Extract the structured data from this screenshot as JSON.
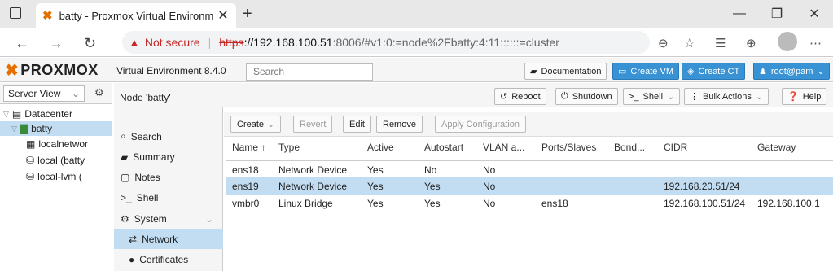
{
  "browser": {
    "tab_title": "batty - Proxmox Virtual Environm",
    "new_tab": "+",
    "address": {
      "warning": "Not secure",
      "scheme": "https",
      "host": "://192.168.100.51",
      "path": ":8006/#v1:0:=node%2Fbatty:4:11::::::=cluster"
    }
  },
  "pve": {
    "logo": "PROXMOX",
    "version": "Virtual Environment 8.4.0",
    "search_placeholder": "Search",
    "buttons": {
      "documentation": "Documentation",
      "create_vm": "Create VM",
      "create_ct": "Create CT",
      "user": "root@pam"
    }
  },
  "server_view": {
    "label": "Server View"
  },
  "tree": [
    {
      "label": "Datacenter"
    },
    {
      "label": "batty"
    },
    {
      "label": "localnetwor"
    },
    {
      "label": "local (batty"
    },
    {
      "label": "local-lvm ("
    }
  ],
  "node": {
    "title": "Node 'batty'",
    "buttons": {
      "reboot": "Reboot",
      "shutdown": "Shutdown",
      "shell": "Shell",
      "bulk": "Bulk Actions",
      "help": "Help"
    }
  },
  "nav": [
    {
      "label": "Search"
    },
    {
      "label": "Summary"
    },
    {
      "label": "Notes"
    },
    {
      "label": "Shell"
    },
    {
      "label": "System"
    },
    {
      "label": "Network"
    },
    {
      "label": "Certificates"
    }
  ],
  "toolbar": {
    "create": "Create",
    "revert": "Revert",
    "edit": "Edit",
    "remove": "Remove",
    "apply": "Apply Configuration"
  },
  "grid": {
    "columns": [
      "Name ↑",
      "Type",
      "Active",
      "Autostart",
      "VLAN a...",
      "Ports/Slaves",
      "Bond...",
      "CIDR",
      "Gateway"
    ],
    "rows": [
      [
        "ens18",
        "Network Device",
        "Yes",
        "No",
        "No",
        "",
        "",
        "",
        ""
      ],
      [
        "ens19",
        "Network Device",
        "Yes",
        "Yes",
        "No",
        "",
        "",
        "192.168.20.51/24",
        ""
      ],
      [
        "vmbr0",
        "Linux Bridge",
        "Yes",
        "Yes",
        "No",
        "ens18",
        "",
        "192.168.100.51/24",
        "192.168.100.1"
      ]
    ]
  }
}
